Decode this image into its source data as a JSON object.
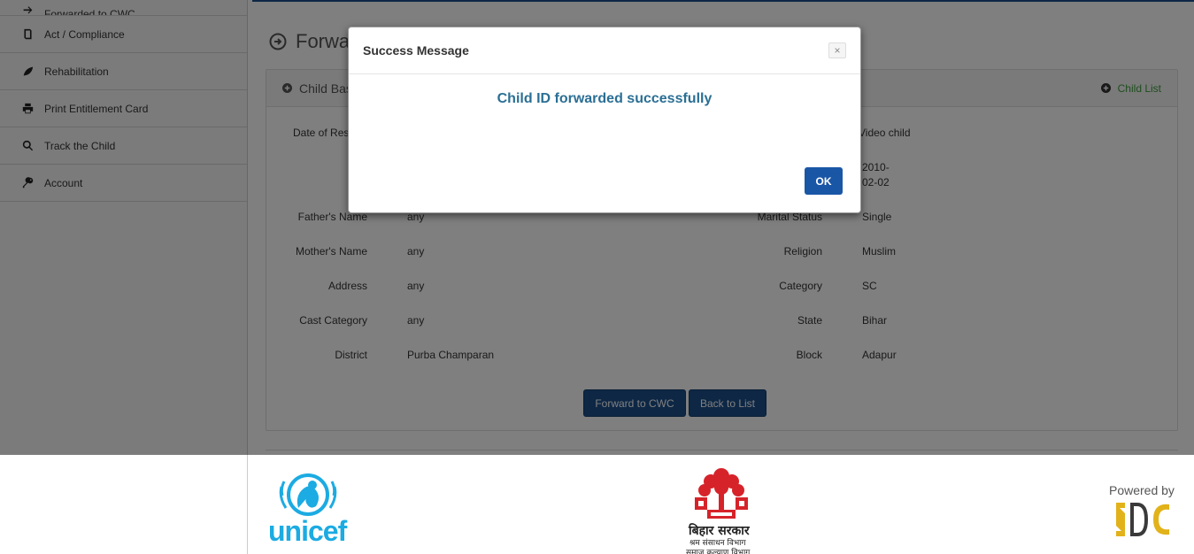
{
  "sidebar": {
    "items": [
      {
        "label": "Forwarded to CWC",
        "icon": "forward-icon"
      },
      {
        "label": "Act / Compliance",
        "icon": "book-icon"
      },
      {
        "label": "Rehabilitation",
        "icon": "leaf-icon"
      },
      {
        "label": "Print Entitlement Card",
        "icon": "print-icon"
      },
      {
        "label": "Track the Child",
        "icon": "search-icon"
      },
      {
        "label": "Account",
        "icon": "key-icon"
      }
    ]
  },
  "page": {
    "title": "Forward to CWC",
    "panel_title": "Child Basic Details",
    "child_list": "Child List"
  },
  "details": {
    "date_label": "Date of Rescue",
    "video_label": "Video child",
    "dob_value_1": "2010-",
    "dob_value_2": "02-02",
    "father_label": "Father's Name",
    "father_value": "any",
    "mother_label": "Mother's Name",
    "mother_value": "any",
    "address_label": "Address",
    "address_value": "any",
    "cast_label": "Cast Category",
    "cast_value": "any",
    "district_label": "District",
    "district_value": "Purba Champaran",
    "marital_label": "Marital Status",
    "marital_value": "Single",
    "religion_label": "Religion",
    "religion_value": "Muslim",
    "category_label": "Category",
    "category_value": "SC",
    "state_label": "State",
    "state_value": "Bihar",
    "block_label": "Block",
    "block_value": "Adapur"
  },
  "buttons": {
    "forward": "Forward to CWC",
    "back": "Back to List"
  },
  "modal": {
    "title": "Success Message",
    "close": "×",
    "message": "Child ID forwarded successfully",
    "ok": "OK"
  },
  "footer": {
    "unicef": "unicef",
    "bihar_line1": "बिहार सरकार",
    "bihar_line2": "श्रम संसाधन विभाग",
    "bihar_line3": "समाज कल्याण विभाग",
    "powered_by": "Powered by"
  },
  "colors": {
    "primary_button": "#1a4f8b",
    "ok_button": "#1a56a6",
    "success_text": "#2a6f94",
    "child_list_link": "#3c9d3c",
    "unicef_blue": "#1cabe2",
    "bihar_red": "#d6232a"
  }
}
